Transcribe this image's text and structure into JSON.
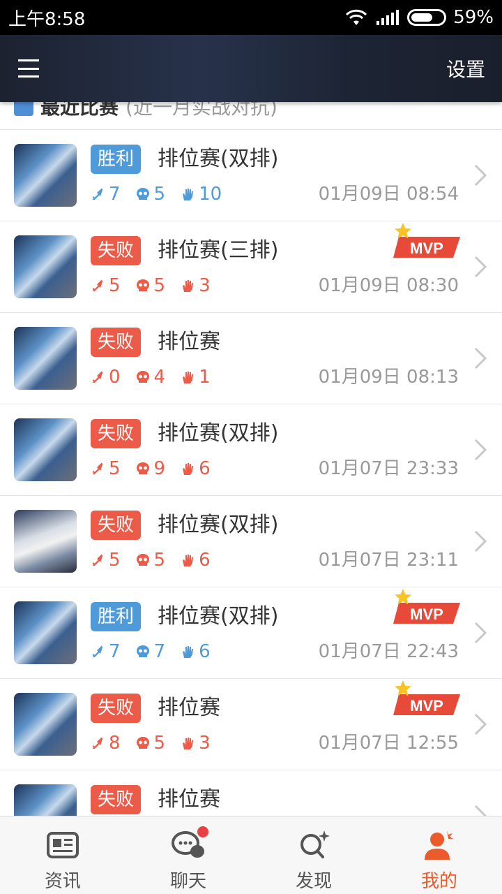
{
  "status_bar": {
    "time": "上午8:58",
    "battery": "59%"
  },
  "app_bar": {
    "settings_label": "设置"
  },
  "section": {
    "title": "最近比赛",
    "subtitle": "(近一月实战对抗)"
  },
  "matches": [
    {
      "result": "胜利",
      "type": "排位赛(双排)",
      "kills": "7",
      "deaths": "5",
      "assists": "10",
      "time": "01月09日 08:54",
      "mvp": ""
    },
    {
      "result": "失败",
      "type": "排位赛(三排)",
      "kills": "5",
      "deaths": "5",
      "assists": "3",
      "time": "01月09日 08:30",
      "mvp": "MVP"
    },
    {
      "result": "失败",
      "type": "排位赛",
      "kills": "0",
      "deaths": "4",
      "assists": "1",
      "time": "01月09日 08:13",
      "mvp": ""
    },
    {
      "result": "失败",
      "type": "排位赛(双排)",
      "kills": "5",
      "deaths": "9",
      "assists": "6",
      "time": "01月07日 23:33",
      "mvp": ""
    },
    {
      "result": "失败",
      "type": "排位赛(双排)",
      "kills": "5",
      "deaths": "5",
      "assists": "6",
      "time": "01月07日 23:11",
      "mvp": ""
    },
    {
      "result": "胜利",
      "type": "排位赛(双排)",
      "kills": "7",
      "deaths": "7",
      "assists": "6",
      "time": "01月07日 22:43",
      "mvp": "MVP"
    },
    {
      "result": "失败",
      "type": "排位赛",
      "kills": "8",
      "deaths": "5",
      "assists": "3",
      "time": "01月07日 12:55",
      "mvp": "MVP"
    },
    {
      "result": "失败",
      "type": "排位赛",
      "kills": "",
      "deaths": "",
      "assists": "",
      "time": "",
      "mvp": ""
    }
  ],
  "bottom_nav": [
    {
      "label": "资讯",
      "icon": "news-icon"
    },
    {
      "label": "聊天",
      "icon": "chat-icon"
    },
    {
      "label": "发现",
      "icon": "discover-icon"
    },
    {
      "label": "我的",
      "icon": "profile-icon"
    }
  ],
  "colors": {
    "win": "#4f9ad9",
    "lose": "#ec5b48",
    "active_tab": "#ec5b2b"
  }
}
